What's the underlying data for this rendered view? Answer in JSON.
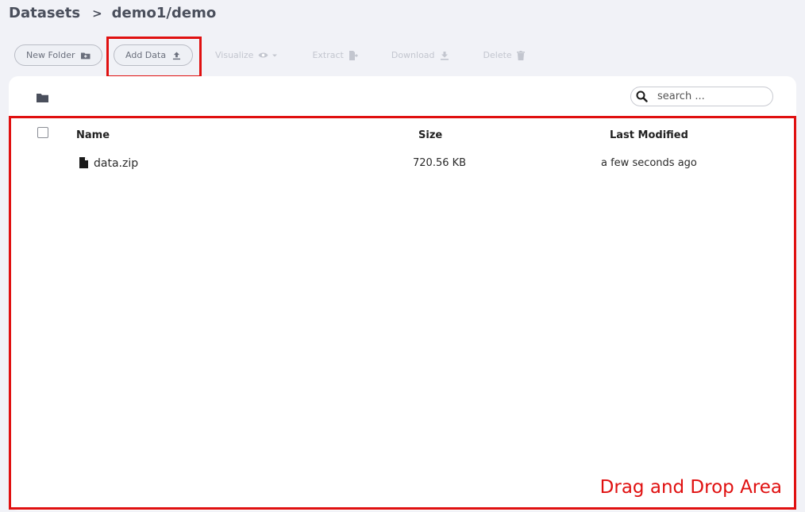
{
  "breadcrumb": {
    "root": "Datasets",
    "separator": ">",
    "current": "demo1/demo"
  },
  "toolbar": {
    "new_folder": "New Folder",
    "add_data": "Add Data",
    "visualize": "Visualize",
    "extract": "Extract",
    "download": "Download",
    "delete": "Delete"
  },
  "search": {
    "placeholder": "search ..."
  },
  "table": {
    "columns": {
      "name": "Name",
      "size": "Size",
      "modified": "Last Modified"
    },
    "rows": [
      {
        "name": "data.zip",
        "size": "720.56 KB",
        "modified": "a few seconds ago"
      }
    ]
  },
  "drop_area": {
    "label": "Drag and Drop Area"
  },
  "colors": {
    "highlight": "#e01010",
    "background": "#f1f2f7",
    "panel": "#ffffff"
  }
}
